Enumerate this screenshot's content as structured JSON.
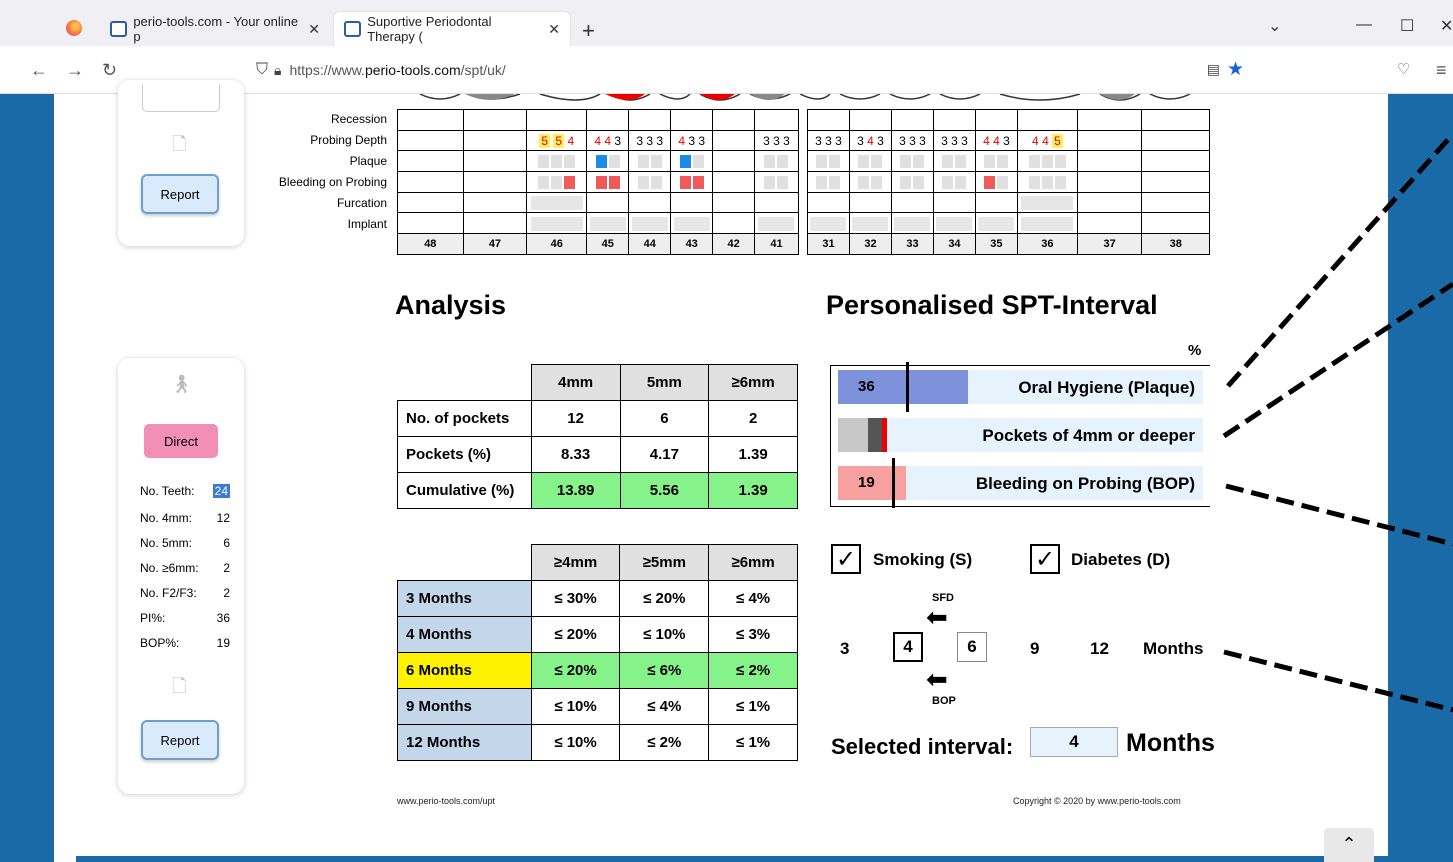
{
  "browser": {
    "tabs": [
      {
        "title": "perio-tools.com - Your online p"
      },
      {
        "title": "Suportive Periodontal Therapy ("
      }
    ],
    "url_prefix": "https://www.",
    "url_domain": "perio-tools.com",
    "url_path": "/spt/uk/"
  },
  "sidebar_top": {
    "report_label": "Report"
  },
  "sidebar_bottom": {
    "direct_label": "Direct",
    "report_label": "Report",
    "stats": [
      {
        "label": "No. Teeth:",
        "value": "24"
      },
      {
        "label": "No. 4mm:",
        "value": "12"
      },
      {
        "label": "No. 5mm:",
        "value": "6"
      },
      {
        "label": "No. ≥6mm:",
        "value": "2"
      },
      {
        "label": "No. F2/F3:",
        "value": "2"
      },
      {
        "label": "PI%:",
        "value": "36"
      },
      {
        "label": "BOP%:",
        "value": "19"
      }
    ]
  },
  "chart": {
    "row_labels": [
      "Recession",
      "Probing Depth",
      "Plaque",
      "Bleeding on Probing",
      "Furcation",
      "Implant"
    ],
    "teeth_right": [
      "48",
      "47",
      "46",
      "45",
      "44",
      "43",
      "42",
      "41"
    ],
    "teeth_left": [
      "31",
      "32",
      "33",
      "34",
      "35",
      "36",
      "37",
      "38"
    ],
    "probing_right": [
      "",
      "",
      "5 5 4",
      "4 4 3",
      "3 3 3",
      "4 3 3",
      "",
      "3 3 3"
    ],
    "probing_left": [
      "3 3 3",
      "3 4 3",
      "3 3 3",
      "3 3 3",
      "4 4 3",
      "4 4 5",
      "",
      ""
    ]
  },
  "analysis": {
    "title": "Analysis",
    "table1": {
      "headers": [
        "",
        "4mm",
        "5mm",
        "≥6mm"
      ],
      "rows": [
        {
          "label": "No. of pockets",
          "values": [
            "12",
            "6",
            "2"
          ]
        },
        {
          "label": "Pockets (%)",
          "values": [
            "8.33",
            "4.17",
            "1.39"
          ]
        },
        {
          "label": "Cumulative (%)",
          "values": [
            "13.89",
            "5.56",
            "1.39"
          ]
        }
      ]
    },
    "table2": {
      "headers": [
        "",
        "≥4mm",
        "≥5mm",
        "≥6mm"
      ],
      "rows": [
        {
          "label": "3 Months",
          "values": [
            "≤ 30%",
            "≤ 20%",
            "≤ 4%"
          ]
        },
        {
          "label": "4 Months",
          "values": [
            "≤ 20%",
            "≤ 10%",
            "≤ 3%"
          ]
        },
        {
          "label": "6 Months",
          "values": [
            "≤ 20%",
            "≤ 6%",
            "≤ 2%"
          ]
        },
        {
          "label": "9 Months",
          "values": [
            "≤ 10%",
            "≤ 4%",
            "≤ 1%"
          ]
        },
        {
          "label": "12 Months",
          "values": [
            "≤ 10%",
            "≤ 2%",
            "≤ 1%"
          ]
        }
      ]
    }
  },
  "spt": {
    "title": "Personalised SPT-Interval",
    "percent_sign": "%",
    "bars": [
      {
        "value": "36",
        "label": "Oral Hygiene (Plaque)",
        "fill_color": "#7e92dc"
      },
      {
        "value": "",
        "label": "Pockets of 4mm or deeper",
        "fill_color": "#c8c8c8"
      },
      {
        "value": "19",
        "label": "Bleeding on Probing (BOP)",
        "fill_color": "#f7a0a0"
      }
    ],
    "smoking_label": "Smoking (S)",
    "diabetes_label": "Diabetes (D)",
    "checkmark": "✓",
    "sfd_label": "SFD",
    "bop_label": "BOP",
    "months": [
      "3",
      "4",
      "6",
      "9",
      "12"
    ],
    "months_word": "Months",
    "selected_label": "Selected interval:",
    "selected_value": "4",
    "selected_unit": "Months"
  },
  "footer": {
    "left": "www.perio-tools.com/upt",
    "right": "Copyright © 2020 by www.perio-tools.com"
  }
}
